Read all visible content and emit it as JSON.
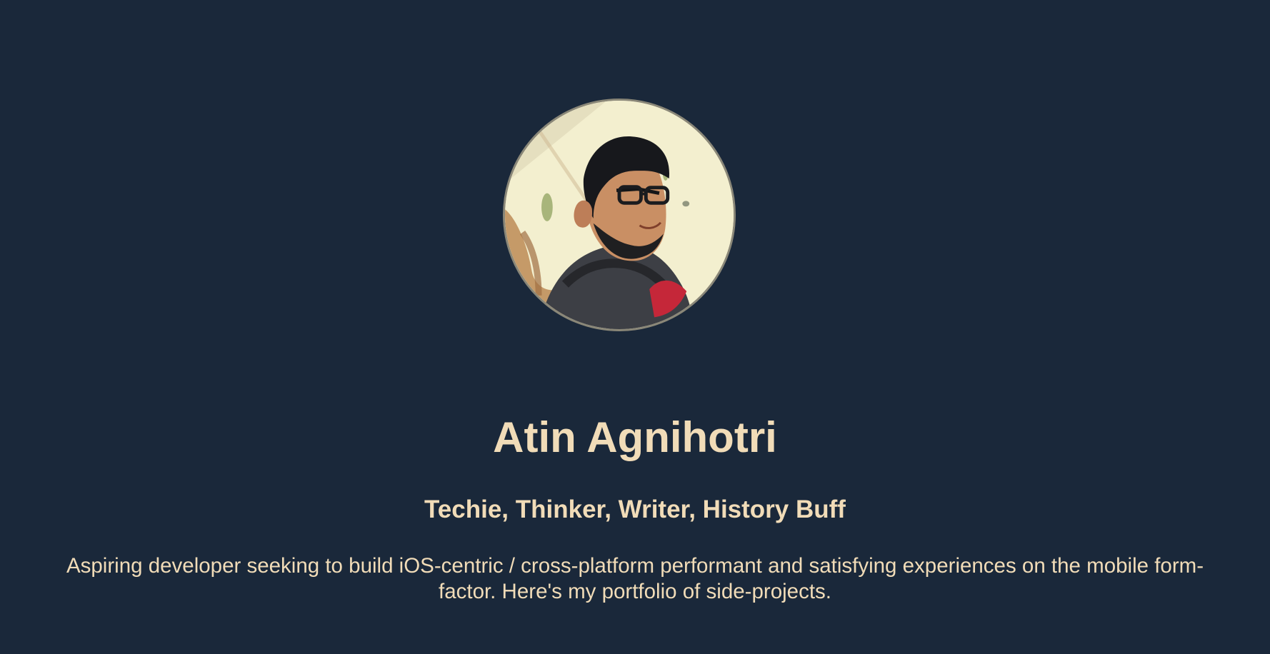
{
  "profile": {
    "avatar_alt": "Atin Agnihotri",
    "name": "Atin Agnihotri",
    "tagline": "Techie, Thinker, Writer, History Buff",
    "bio": "Aspiring developer seeking to build iOS-centric / cross-platform performant and satisfying experiences on the mobile form-factor. Here's my portfolio of side-projects."
  },
  "colors": {
    "background": "#1a283a",
    "text": "#f1dcb8",
    "avatar_border": "#8a8778"
  }
}
